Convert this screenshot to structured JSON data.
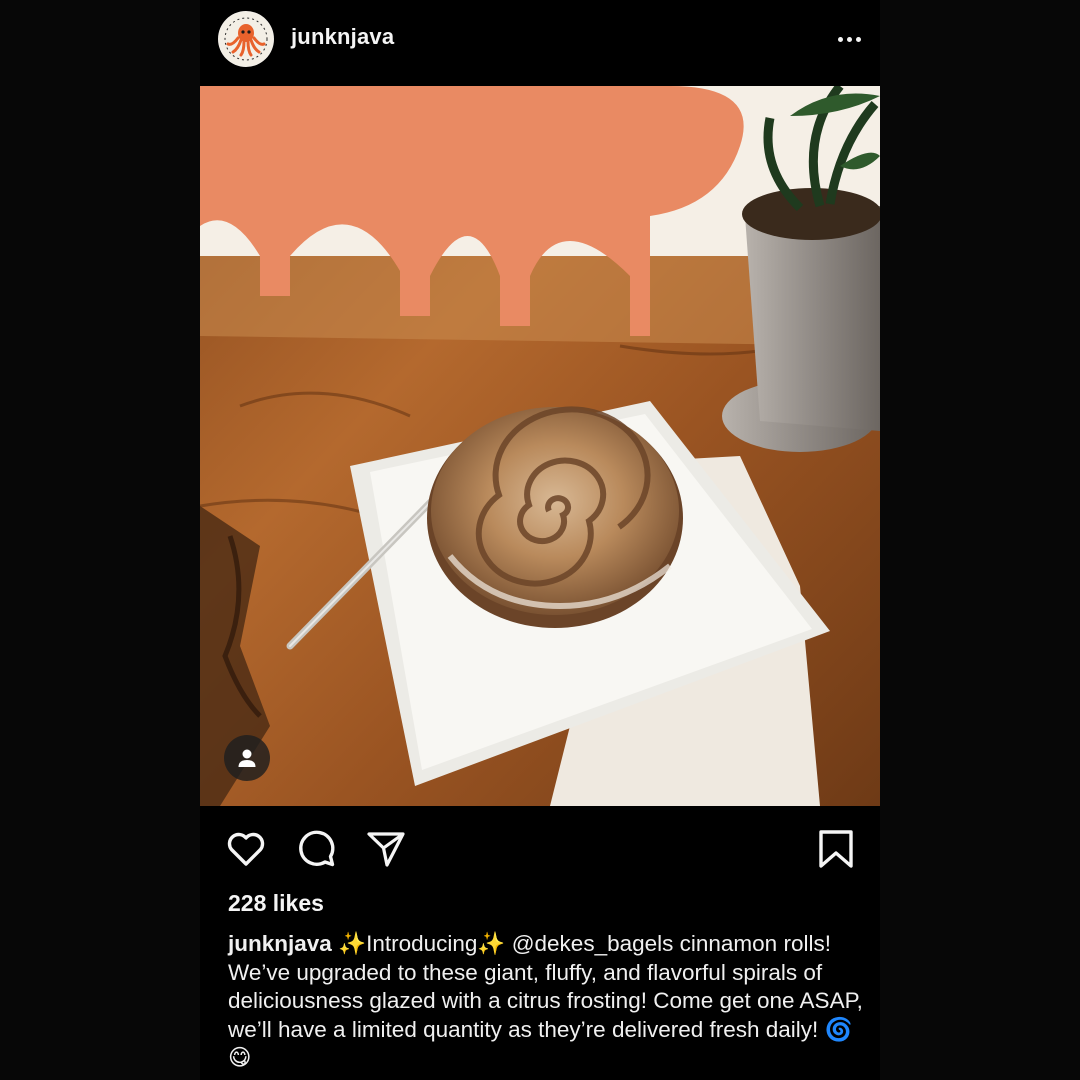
{
  "post": {
    "username": "junknjava",
    "avatar_icon": "octopus-logo-icon",
    "more_icon": "more-options-icon",
    "photo_description_icon": "cinnamon-roll-photo",
    "tag_icon": "tagged-person-icon",
    "likes_text": "228 likes",
    "caption": {
      "username": "junknjava",
      "sparkle_1": "✨",
      "intro": "Introducing",
      "sparkle_2": "✨",
      "mention": "@dekes_bagels",
      "body": " cinnamon rolls! We’ve upgraded to these giant, fluffy, and flavorful spirals of deliciousness glazed with a citrus frosting! Come get one ASAP, we’ll have a limited quantity as they’re delivered fresh daily! ",
      "emoji_1": "🌀",
      "emoji_2": "😋"
    }
  },
  "actions": {
    "like_icon": "heart-icon",
    "comment_icon": "comment-icon",
    "share_icon": "send-icon",
    "save_icon": "bookmark-icon"
  },
  "colors": {
    "background": "#000000",
    "text": "#f5f5f5",
    "avatar_accent": "#e8622c"
  }
}
